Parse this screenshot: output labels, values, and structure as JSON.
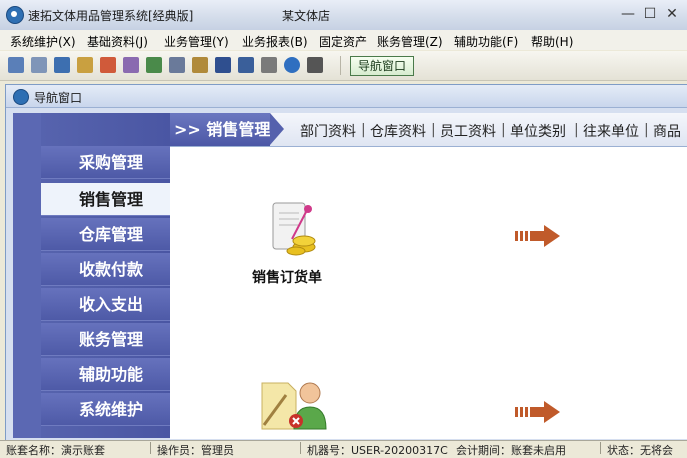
{
  "window": {
    "title": "速拓文体用品管理系统[经典版]",
    "store": "某文体店",
    "minimize": "—",
    "restore": "☐",
    "close": "✕"
  },
  "menu": [
    "系统维护(X)",
    "基础资料(J)",
    "业务管理(Y)",
    "业务报表(B)",
    "固定资产",
    "账务管理(Z)",
    "辅助功能(F)",
    "帮助(H)"
  ],
  "toolbar": {
    "nav_button": "导航窗口",
    "icons": [
      "list-icon",
      "form-icon",
      "windows-icon",
      "search-icon",
      "chart-icon",
      "tools-icon",
      "users-icon",
      "print-preview-icon",
      "edit-icon",
      "database-icon",
      "save-icon",
      "printer-icon",
      "help-icon",
      "exit-icon"
    ]
  },
  "subwindow": {
    "title": "导航窗口"
  },
  "sidebar": {
    "items": [
      "采购管理",
      "销售管理",
      "仓库管理",
      "收款付款",
      "收入支出",
      "账务管理",
      "辅助功能",
      "系统维护"
    ],
    "active": "销售管理"
  },
  "tabs": {
    "current": ">> 销售管理",
    "links": [
      "部门资料",
      "仓库资料",
      "员工资料",
      "单位类别",
      "往来单位",
      "商品"
    ]
  },
  "content": {
    "sales_order_label": "销售订货单"
  },
  "statusbar": {
    "account": "账套名称：演示账套",
    "operator": "操作员：管理员",
    "machine": "机器号：USER-20200317C",
    "period": "会计期间：账套未启用",
    "status": "状态：无将会"
  },
  "colors": {
    "nav_bg": "#5966b0",
    "active_bg": "#eef3fb",
    "arrow": "#c05a2a"
  }
}
